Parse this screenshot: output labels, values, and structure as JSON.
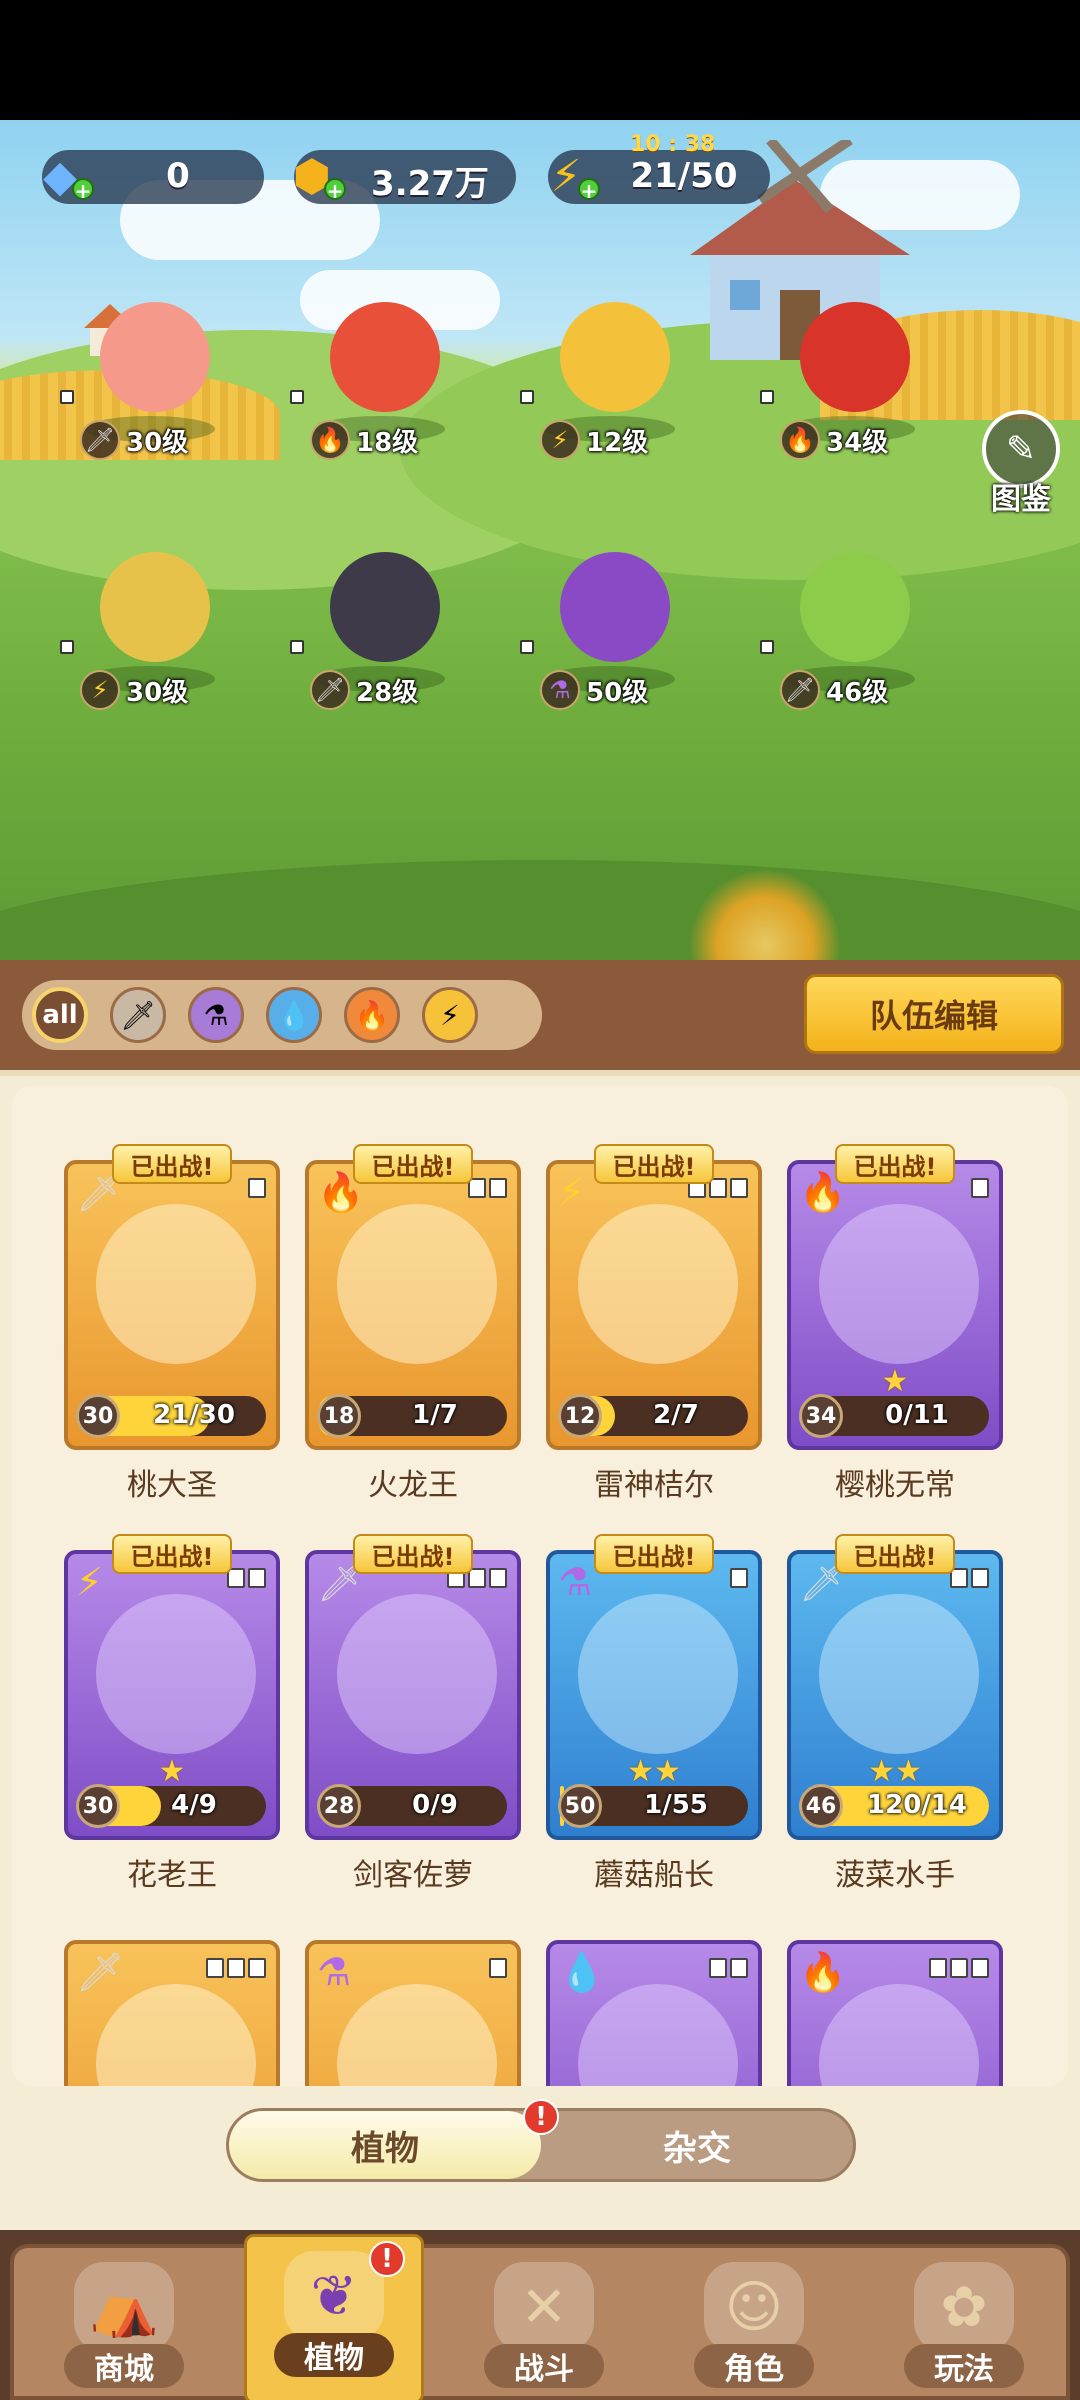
{
  "resources": {
    "gems": "0",
    "coins": "3.27万",
    "energy": "21/50",
    "energy_timer": "10 : 38"
  },
  "codex_label": "图鉴",
  "team": [
    {
      "element": "sword-icon",
      "level": "30级"
    },
    {
      "element": "fire-icon",
      "level": "18级"
    },
    {
      "element": "lightning-icon",
      "level": "12级"
    },
    {
      "element": "fire-icon",
      "level": "34级"
    },
    {
      "element": "lightning-icon",
      "level": "30级"
    },
    {
      "element": "sword-icon",
      "level": "28级"
    },
    {
      "element": "potion-icon",
      "level": "50级"
    },
    {
      "element": "sword-icon",
      "level": "46级"
    }
  ],
  "filters": {
    "all_label": "all",
    "items": [
      "sword-icon",
      "potion-icon",
      "water-icon",
      "fire-icon",
      "lightning-icon"
    ]
  },
  "team_edit_label": "队伍编辑",
  "deployed_label": "已出战!",
  "cards": [
    {
      "name": "桃大圣",
      "level": "30",
      "progress": "21/30",
      "fill": 0.7,
      "rarity": "gold",
      "element": "sword-icon",
      "stars": "",
      "deployed": true
    },
    {
      "name": "火龙王",
      "level": "18",
      "progress": "1/7",
      "fill": 0.14,
      "rarity": "gold",
      "element": "fire-icon",
      "stars": "",
      "deployed": true
    },
    {
      "name": "雷神桔尔",
      "level": "12",
      "progress": "2/7",
      "fill": 0.29,
      "rarity": "gold",
      "element": "lightning-icon",
      "stars": "",
      "deployed": true
    },
    {
      "name": "樱桃无常",
      "level": "34",
      "progress": "0/11",
      "fill": 0,
      "rarity": "purple",
      "element": "fire-icon",
      "stars": "★",
      "deployed": true
    },
    {
      "name": "花老王",
      "level": "30",
      "progress": "4/9",
      "fill": 0.44,
      "rarity": "purple",
      "element": "lightning-icon",
      "stars": "★",
      "deployed": true
    },
    {
      "name": "剑客佐萝",
      "level": "28",
      "progress": "0/9",
      "fill": 0,
      "rarity": "purple",
      "element": "sword-icon",
      "stars": "",
      "deployed": true
    },
    {
      "name": "蘑菇船长",
      "level": "50",
      "progress": "1/55",
      "fill": 0.02,
      "rarity": "blue",
      "element": "potion-icon",
      "stars": "★★",
      "deployed": true
    },
    {
      "name": "菠菜水手",
      "level": "46",
      "progress": "120/14",
      "fill": 1,
      "rarity": "blue",
      "element": "sword-icon",
      "stars": "★★",
      "deployed": true
    },
    {
      "name": "",
      "level": "",
      "progress": "",
      "fill": 0,
      "rarity": "gold",
      "element": "sword-icon",
      "stars": "",
      "deployed": false
    },
    {
      "name": "",
      "level": "",
      "progress": "",
      "fill": 0,
      "rarity": "gold",
      "element": "potion-icon",
      "stars": "",
      "deployed": false
    },
    {
      "name": "",
      "level": "",
      "progress": "",
      "fill": 0,
      "rarity": "purple",
      "element": "water-icon",
      "stars": "",
      "deployed": false
    },
    {
      "name": "",
      "level": "",
      "progress": "",
      "fill": 0,
      "rarity": "purple",
      "element": "fire-icon",
      "stars": "",
      "deployed": false
    }
  ],
  "switch": {
    "plants": "植物",
    "hybrid": "杂交",
    "alert": "!"
  },
  "nav": [
    {
      "label": "商城",
      "icon": "shop-icon"
    },
    {
      "label": "植物",
      "icon": "plants-icon",
      "alert": "!"
    },
    {
      "label": "战斗",
      "icon": "battle-icon"
    },
    {
      "label": "角色",
      "icon": "character-icon"
    },
    {
      "label": "玩法",
      "icon": "gameplay-icon"
    }
  ]
}
